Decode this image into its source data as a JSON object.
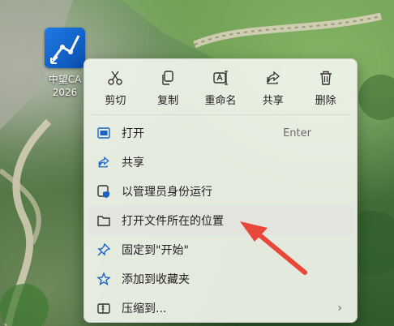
{
  "desktop_icon": {
    "line1": "中望CA",
    "line2": "2026"
  },
  "context_menu": {
    "actions": [
      {
        "label": "剪切",
        "icon": "scissors-icon"
      },
      {
        "label": "复制",
        "icon": "copy-icon"
      },
      {
        "label": "重命名",
        "icon": "rename-icon"
      },
      {
        "label": "共享",
        "icon": "share-icon"
      },
      {
        "label": "删除",
        "icon": "trash-icon"
      }
    ],
    "items": [
      {
        "label": "打开",
        "shortcut": "Enter",
        "icon": "open-window-icon"
      },
      {
        "label": "共享",
        "icon": "share-icon"
      },
      {
        "label": "以管理员身份运行",
        "icon": "admin-shield-icon"
      },
      {
        "label": "打开文件所在的位置",
        "icon": "folder-icon",
        "highlighted": true
      },
      {
        "label": "固定到\"开始\"",
        "icon": "pin-icon"
      },
      {
        "label": "添加到收藏夹",
        "icon": "star-icon"
      },
      {
        "label": "压缩到...",
        "icon": "archive-icon",
        "submenu_chevron": "›"
      }
    ]
  },
  "colors": {
    "annotation_arrow": "#e8473a",
    "icon_blue": "#1a63c5",
    "menu_bg": "#f0f4eb"
  }
}
